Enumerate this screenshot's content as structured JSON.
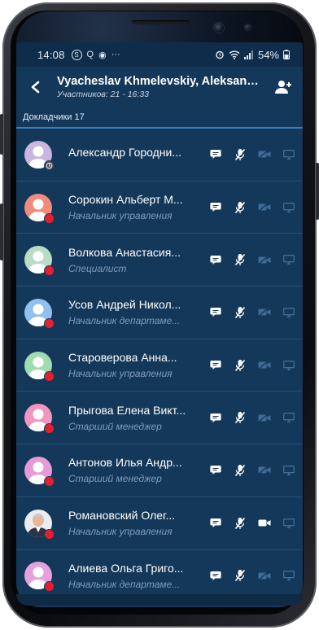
{
  "status": {
    "time": "14:08",
    "icons_left": [
      "S",
      "Q",
      "◉",
      "···"
    ],
    "battery": "54%"
  },
  "header": {
    "title": "Vyacheslav Khmelevskiy, Aleksandr...",
    "subtitle": "Участников: 21 - 16:33"
  },
  "section": {
    "label": "Докладчики 17"
  },
  "colors": {
    "screen": "#14385a",
    "busy": "#e5202e",
    "accent": "#3a7fc0"
  },
  "participants": [
    {
      "name": "Александр Городни...",
      "role": "",
      "avatar": "#c9b6de",
      "status": "away",
      "video": false
    },
    {
      "name": "Сорокин Альберт М...",
      "role": "Начальник управления",
      "avatar": "#f08c7e",
      "status": "busy",
      "video": false
    },
    {
      "name": "Волкова Анастасия...",
      "role": "Специалист",
      "avatar": "#b8dcc4",
      "status": "busy",
      "video": false
    },
    {
      "name": "Усов Андрей Никол...",
      "role": "Начальник департаме...",
      "avatar": "#8fc0ee",
      "status": "busy",
      "video": false
    },
    {
      "name": "Староверова Анна...",
      "role": "Начальник управления",
      "avatar": "#9fdcb0",
      "status": "busy",
      "video": false
    },
    {
      "name": "Прыгова Елена Викт...",
      "role": "Старший менеджер",
      "avatar": "#f196c0",
      "status": "busy",
      "video": false
    },
    {
      "name": "Антонов Илья Андр...",
      "role": "Старший менеджер",
      "avatar": "#e79ad6",
      "status": "busy",
      "video": false
    },
    {
      "name": "Романовский Олег...",
      "role": "Начальник управления",
      "avatar": "photo",
      "status": "busy",
      "video": true
    },
    {
      "name": "Алиева Ольга Григо...",
      "role": "Начальник департаме...",
      "avatar": "#e6a0de",
      "status": "busy",
      "video": false
    }
  ]
}
